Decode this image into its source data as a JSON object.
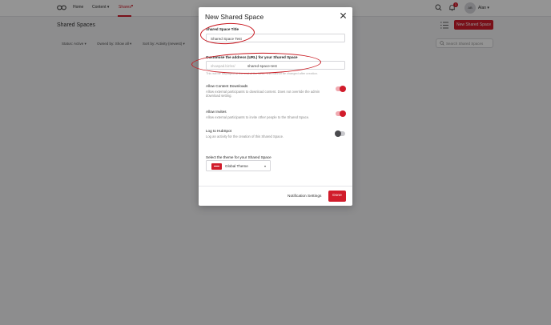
{
  "nav": {
    "items": [
      "Home",
      "Content",
      "Shares"
    ],
    "content_chevron": "▾",
    "user": {
      "initials": "AB",
      "name": "Alan",
      "chevron": "▾"
    },
    "notifications_count": "1"
  },
  "page": {
    "title": "Shared Spaces",
    "new_button_label": "New Shared Space",
    "filters": [
      "Status: Active ▾",
      "Owned by: Show all ▾",
      "Sort by: Activity (newest) ▾"
    ],
    "search_placeholder": "Search Shared Spaces"
  },
  "modal": {
    "title": "New Shared Space",
    "close_icon": "close-icon",
    "title_field": {
      "label": "Shared Space Title",
      "value": "Shared Space Test"
    },
    "url_field": {
      "label": "Customise the address (URL) for your Shared Space",
      "prefix": "showpad.biz/ss/",
      "slug": "shared-space-test",
      "help": "This will be displayed at the end of the URL. This cannot be changed after creation."
    },
    "toggles": [
      {
        "title": "Allow Content Downloads",
        "desc": "Allow external participants to download content. Does not override the admin download setting.",
        "on": true
      },
      {
        "title": "Allow Invites",
        "desc": "Allow external participants to invite other people to the Shared Space.",
        "on": true
      },
      {
        "title": "Log to HubSpot",
        "desc": "Log an activity for the creation of this Shared Space.",
        "on": false
      }
    ],
    "theme": {
      "label": "Select the theme for your Shared Space",
      "selected": "Global Theme",
      "chevron": "▾"
    },
    "footer": {
      "notification_settings": "Notification Settings",
      "done": "Done"
    }
  },
  "colors": {
    "accent": "#d11c2b",
    "annotation": "#c8141c"
  }
}
